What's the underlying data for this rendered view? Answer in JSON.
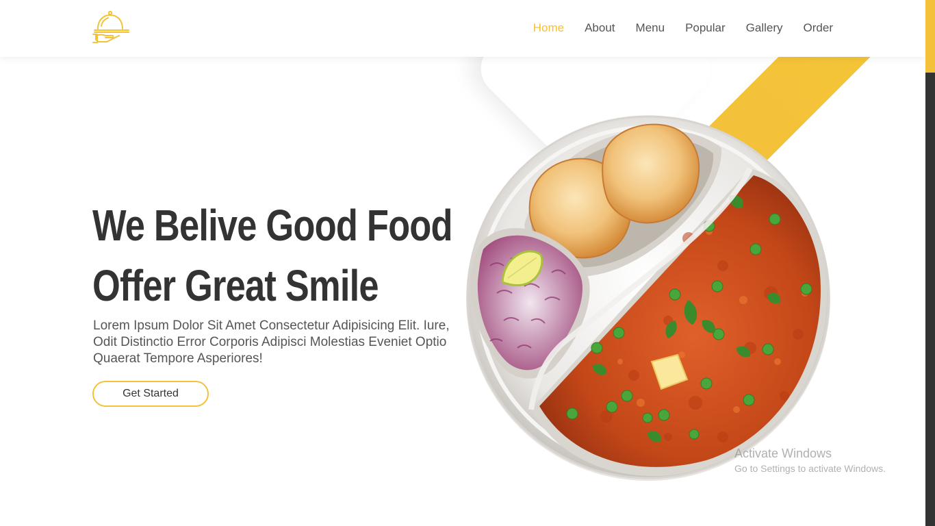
{
  "header": {
    "logo_icon": "serving-cloche-hand-icon",
    "nav": [
      {
        "label": "Home",
        "active": true
      },
      {
        "label": "About",
        "active": false
      },
      {
        "label": "Menu",
        "active": false
      },
      {
        "label": "Popular",
        "active": false
      },
      {
        "label": "Gallery",
        "active": false
      },
      {
        "label": "Order",
        "active": false
      }
    ]
  },
  "hero": {
    "title_line1": "We Belive Good Food",
    "title_line2": "Offer Great Smile",
    "description": "Lorem Ipsum Dolor Sit Amet Consectetur Adipisicing Elit. Iure, Odit Distinctio Error Corporis Adipisci Molestias Eveniet Optio Quaerat Tempore Asperiores!",
    "cta_label": "Get Started",
    "image": "pav-bhaji-plate"
  },
  "watermark": {
    "line1": "Activate Windows",
    "line2": "Go to Settings to activate Windows."
  },
  "colors": {
    "accent": "#f3c13a",
    "text_dark": "#333333",
    "text_body": "#555555",
    "scrollbar_track": "#333333"
  }
}
